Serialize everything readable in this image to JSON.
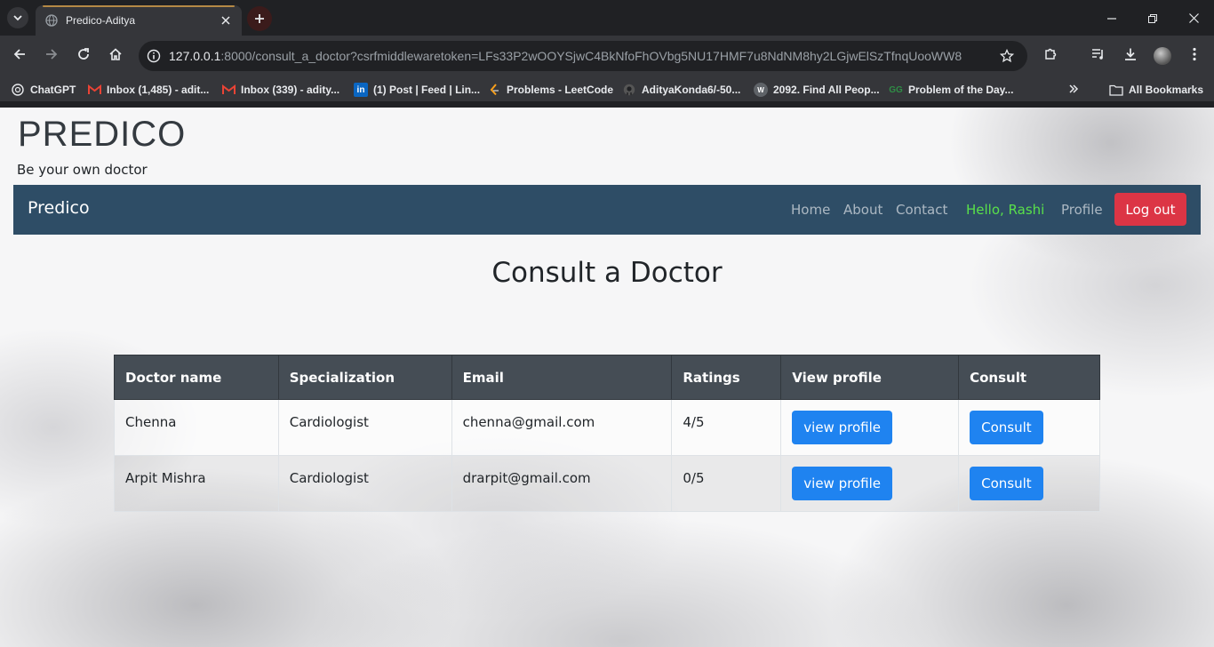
{
  "browser": {
    "tab_title": "Predico-Aditya",
    "url_host": "127.0.0.1",
    "url_rest": ":8000/consult_a_doctor?csrfmiddlewaretoken=LFs33P2wOOYSjwC4BkNfoFhOVbg5NU17HMF7u8NdNM8hy2LGjwElSzTfnqUooWW8",
    "bookmarks": [
      {
        "label": "ChatGPT",
        "icon": "chatgpt-icon"
      },
      {
        "label": "Inbox (1,485) - adit...",
        "icon": "gmail-icon"
      },
      {
        "label": "Inbox (339) - adity...",
        "icon": "gmail-icon"
      },
      {
        "label": "(1) Post | Feed | Lin...",
        "icon": "linkedin-icon"
      },
      {
        "label": "Problems - LeetCode",
        "icon": "leetcode-icon"
      },
      {
        "label": "AdityaKonda6/-50...",
        "icon": "github-icon"
      },
      {
        "label": "2092. Find All Peop...",
        "icon": "web-icon"
      },
      {
        "label": "Problem of the Day...",
        "icon": "gfg-icon"
      }
    ],
    "all_bookmarks_label": "All Bookmarks"
  },
  "site": {
    "title": "PREDICO",
    "tagline": "Be your own doctor"
  },
  "navbar": {
    "brand": "Predico",
    "links": [
      "Home",
      "About",
      "Contact"
    ],
    "greeting": "Hello, Rashi",
    "profile": "Profile",
    "logout": "Log out"
  },
  "main": {
    "heading": "Consult a Doctor"
  },
  "table": {
    "headers": [
      "Doctor name",
      "Specialization",
      "Email",
      "Ratings",
      "View profile",
      "Consult"
    ],
    "rows": [
      {
        "name": "Chenna",
        "specialization": "Cardiologist",
        "email": "chenna@gmail.com",
        "rating": "4/5",
        "view_label": "view profile",
        "consult_label": "Consult"
      },
      {
        "name": "Arpit Mishra",
        "specialization": "Cardiologist",
        "email": "drarpit@gmail.com",
        "rating": "0/5",
        "view_label": "view profile",
        "consult_label": "Consult"
      }
    ]
  },
  "colors": {
    "navbar_bg": "#2e4d66",
    "greeting": "#59e04a",
    "logout_bg": "#dc3545",
    "primary_btn": "#1f83f0",
    "table_header_bg": "#454d55"
  }
}
